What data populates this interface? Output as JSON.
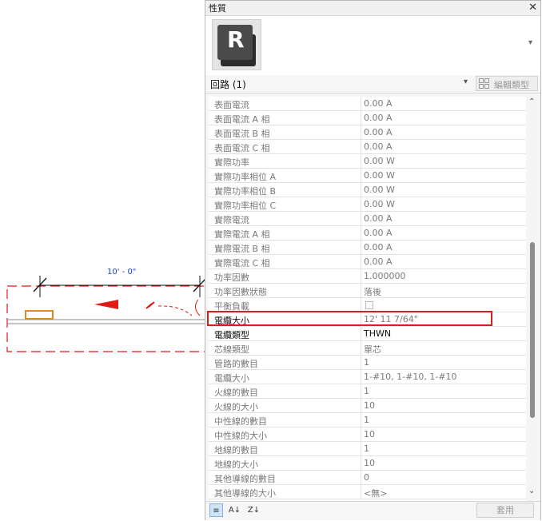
{
  "canvas": {
    "dimension_text": "10' - 0\""
  },
  "panel": {
    "title": "性質",
    "close_glyph": "✕",
    "logo_letter": "R",
    "category": "回路 (1)",
    "edit_type_label": "編輯類型",
    "apply_label": "套用",
    "footer_icons": [
      "properties-list-icon",
      "sort-ascending-icon",
      "sort-descending-icon"
    ],
    "footer_glyphs": [
      "≡",
      "A↓",
      "Z↓"
    ],
    "rows": [
      {
        "name": "表面電流",
        "value": "0.00 A"
      },
      {
        "name": "表面電流 A 相",
        "value": "0.00 A"
      },
      {
        "name": "表面電流 B 相",
        "value": "0.00 A"
      },
      {
        "name": "表面電流 C 相",
        "value": "0.00 A"
      },
      {
        "name": "實際功率",
        "value": "0.00 W"
      },
      {
        "name": "實際功率相位 A",
        "value": "0.00 W"
      },
      {
        "name": "實際功率相位 B",
        "value": "0.00 W"
      },
      {
        "name": "實際功率相位 C",
        "value": "0.00 W"
      },
      {
        "name": "實際電流",
        "value": "0.00 A"
      },
      {
        "name": "實際電流 A 相",
        "value": "0.00 A"
      },
      {
        "name": "實際電流 B 相",
        "value": "0.00 A"
      },
      {
        "name": "實際電流 C 相",
        "value": "0.00 A"
      },
      {
        "name": "功率因數",
        "value": "1.000000"
      },
      {
        "name": "功率因數狀態",
        "value": "落後"
      },
      {
        "name": "平衡負載",
        "value": ""
      },
      {
        "name": "電纜大小",
        "value": "12'  11 7/64\""
      },
      {
        "name": "電纜類型",
        "value": "THWN"
      },
      {
        "name": "芯線類型",
        "value": "單芯"
      },
      {
        "name": "管路的數目",
        "value": "1"
      },
      {
        "name": "電纜大小",
        "value": "1-#10, 1-#10, 1-#10"
      },
      {
        "name": "火線的數目",
        "value": "1"
      },
      {
        "name": "火線的大小",
        "value": "10"
      },
      {
        "name": "中性線的數目",
        "value": "1"
      },
      {
        "name": "中性線的大小",
        "value": "10"
      },
      {
        "name": "地線的數目",
        "value": "1"
      },
      {
        "name": "地線的大小",
        "value": "10"
      },
      {
        "name": "其他導線的數目",
        "value": "0"
      },
      {
        "name": "其他導線的大小",
        "value": "<無>"
      }
    ]
  },
  "colors": {
    "highlight": "#d42020",
    "dimension": "#1a44c8",
    "circuit_red": "#e01818"
  }
}
